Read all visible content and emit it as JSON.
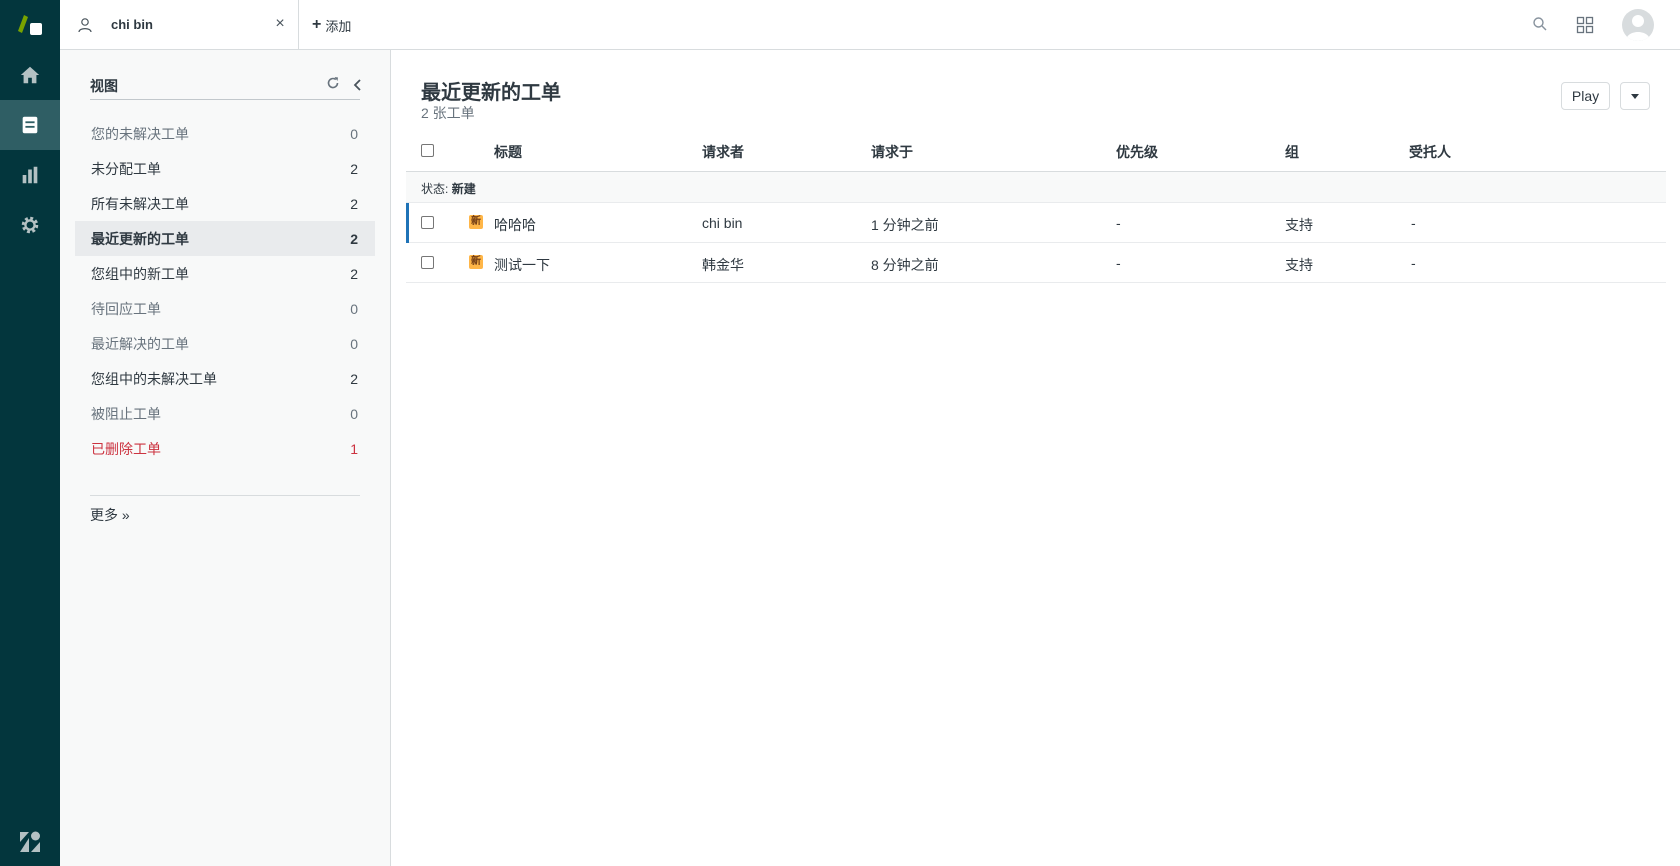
{
  "rail": {
    "items": [
      {
        "name": "home"
      },
      {
        "name": "views"
      },
      {
        "name": "reporting"
      },
      {
        "name": "admin"
      }
    ]
  },
  "topbar": {
    "tab_label": "chi bin",
    "add_label": "添加"
  },
  "views_panel": {
    "title": "视图",
    "items": [
      {
        "label": "您的未解决工单",
        "count": "0"
      },
      {
        "label": "未分配工单",
        "count": "2"
      },
      {
        "label": "所有未解决工单",
        "count": "2"
      },
      {
        "label": "最近更新的工单",
        "count": "2"
      },
      {
        "label": "您组中的新工单",
        "count": "2"
      },
      {
        "label": "待回应工单",
        "count": "0"
      },
      {
        "label": "最近解决的工单",
        "count": "0"
      },
      {
        "label": "您组中的未解决工单",
        "count": "2"
      },
      {
        "label": "被阻止工单",
        "count": "0"
      },
      {
        "label": "已删除工单",
        "count": "1"
      }
    ],
    "more_label": "更多 »"
  },
  "main": {
    "title": "最近更新的工单",
    "subtitle": "2 张工单",
    "play_label": "Play",
    "columns": [
      "标题",
      "请求者",
      "请求于",
      "优先级",
      "组",
      "受托人"
    ],
    "group_prefix": "状态:",
    "group_value": "新建",
    "rows": [
      {
        "badge": "新",
        "title": "哈哈哈",
        "requester": "chi bin",
        "requested": "1 分钟之前",
        "priority": "-",
        "group": "支持",
        "assignee": "-"
      },
      {
        "badge": "新",
        "title": "测试一下",
        "requester": "韩金华",
        "requested": "8 分钟之前",
        "priority": "-",
        "group": "支持",
        "assignee": "-"
      }
    ]
  },
  "colors": {
    "rail_bg": "#03363d",
    "rail_active": "#2f5e64",
    "badge_new": "#ffb648",
    "deleted_red": "#cc3340",
    "accent_blue": "#1f73b7"
  }
}
